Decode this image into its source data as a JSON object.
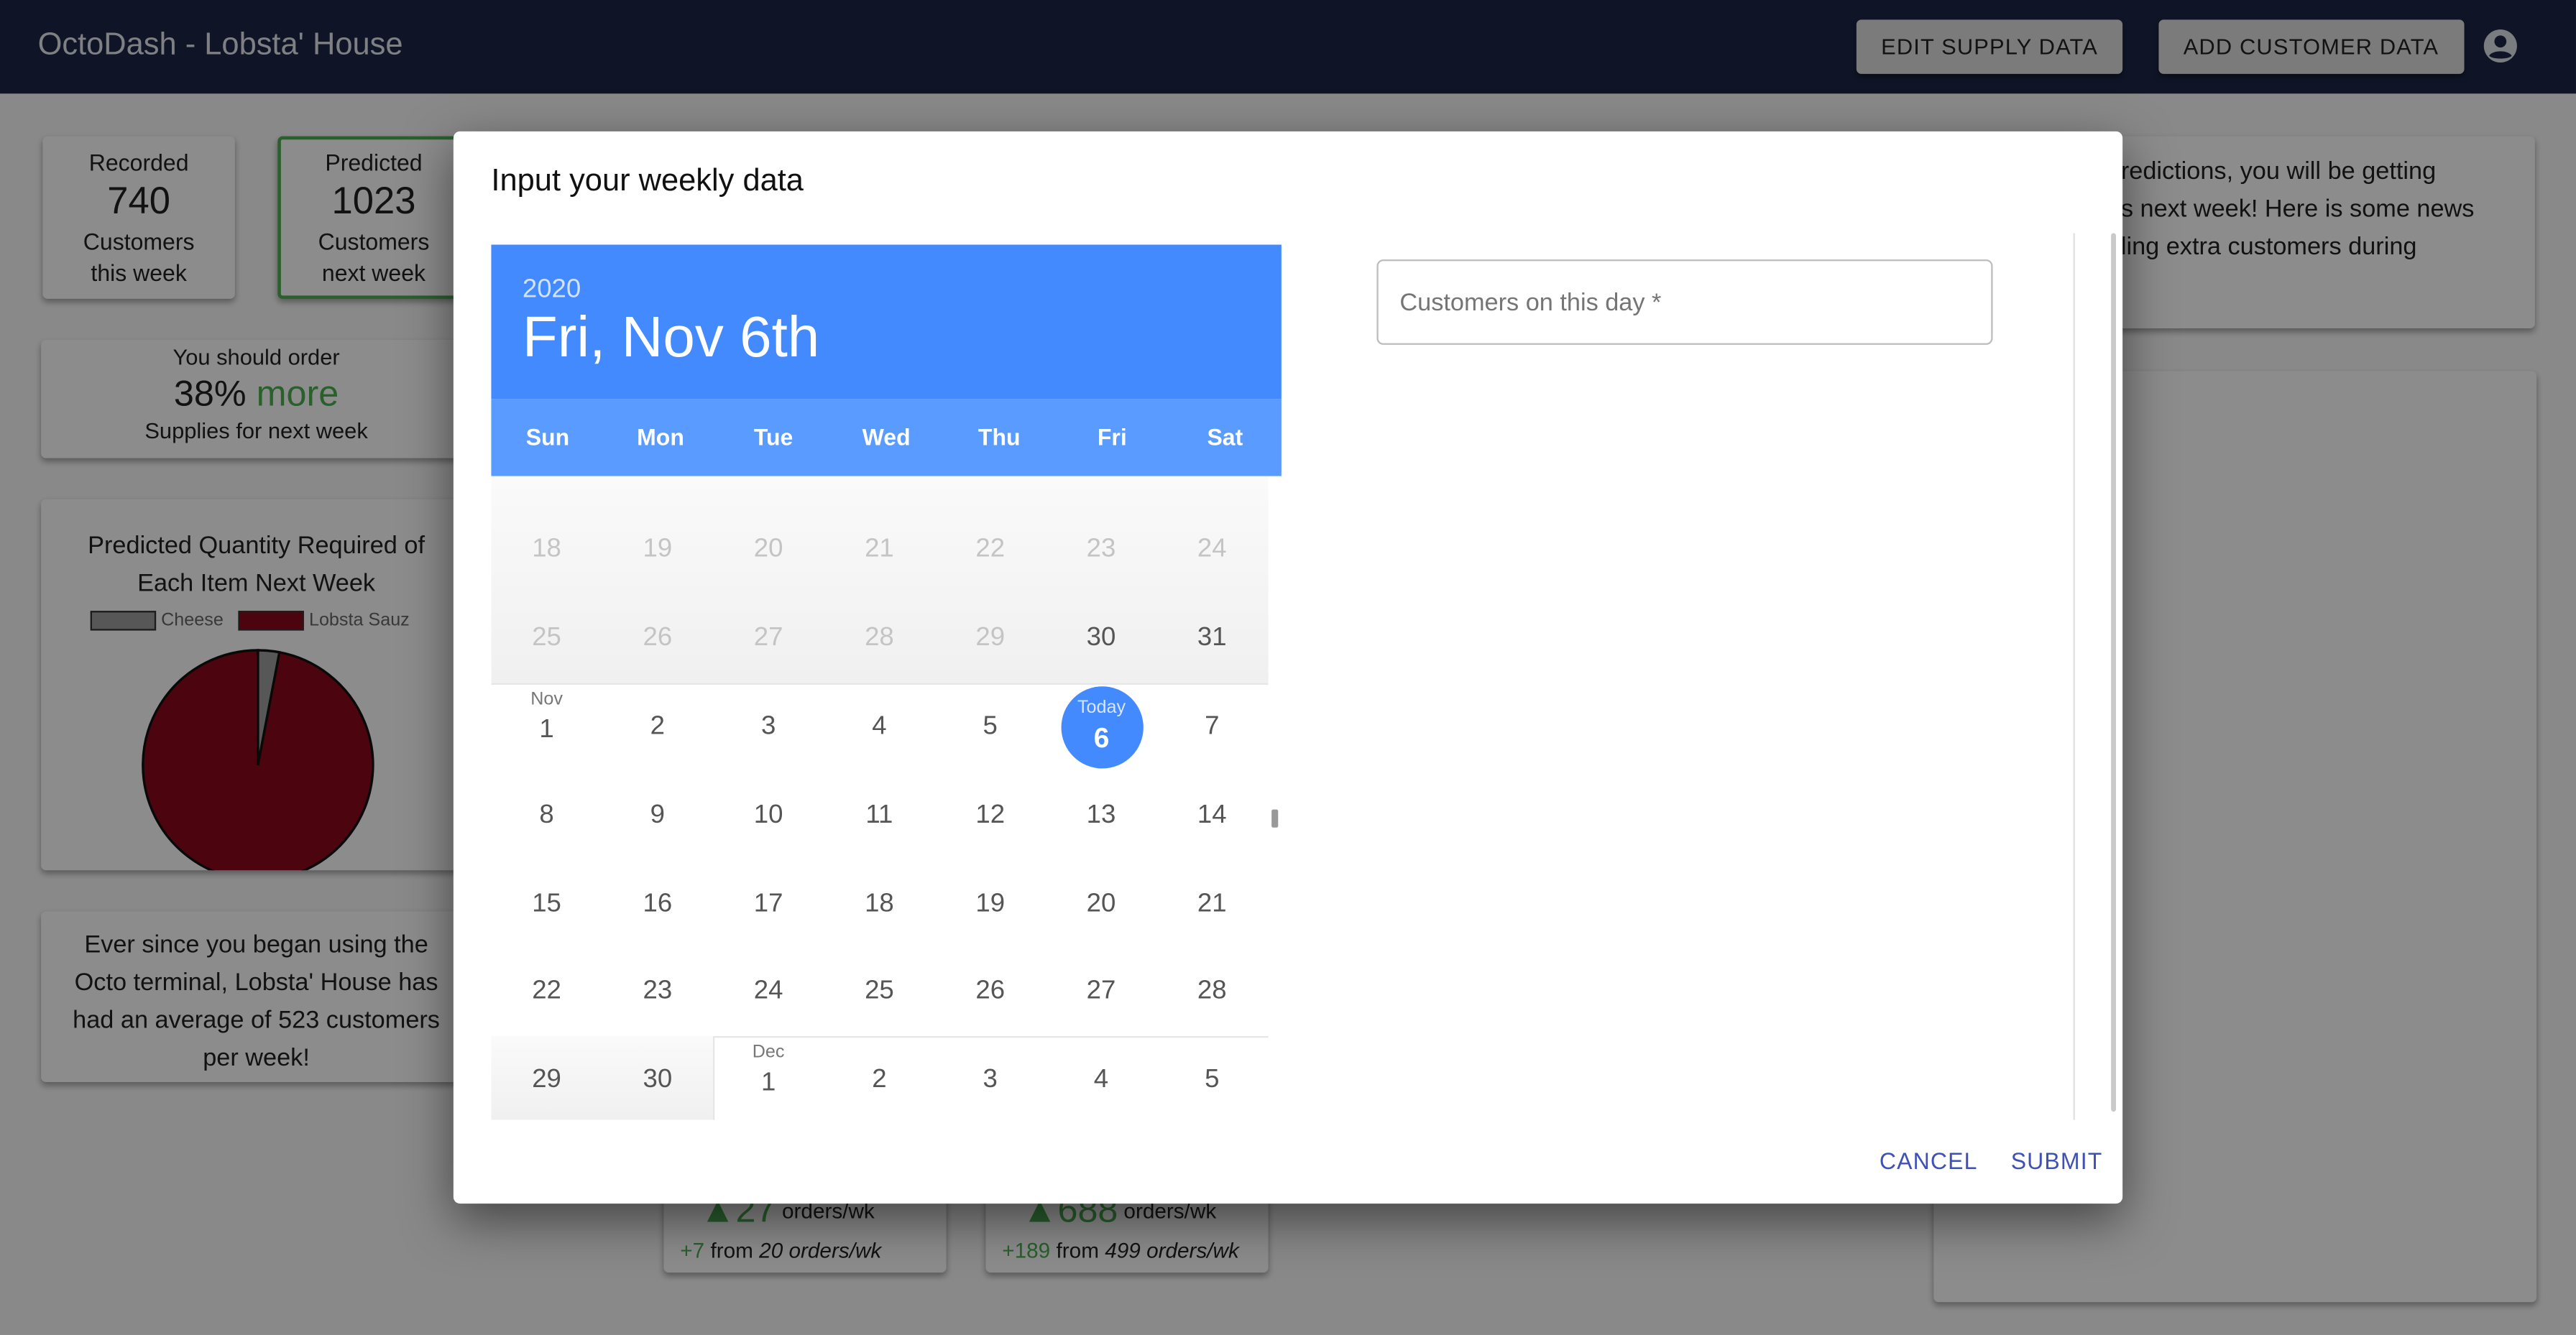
{
  "app": {
    "title": "OctoDash - Lobsta' House",
    "edit_supply_label": "EDIT SUPPLY DATA",
    "add_customer_label": "ADD CUSTOMER DATA",
    "account_icon": "account-circle-icon"
  },
  "stats": {
    "recorded": {
      "top": "Recorded",
      "value": "740",
      "line1": "Customers",
      "line2": "this week"
    },
    "predicted": {
      "top": "Predicted",
      "value": "1023",
      "line1": "Customers",
      "line2": "next week"
    }
  },
  "order": {
    "top": "You should order",
    "pct": "38%",
    "word": "more",
    "bottom": "Supplies for next week"
  },
  "pie": {
    "title1": "Predicted Quantity Required of",
    "title2": "Each Item Next Week",
    "legend": [
      {
        "name": "Cheese",
        "color": "#9e9e9e"
      },
      {
        "name": "Lobsta Sauz",
        "color": "#8b0a1a"
      }
    ]
  },
  "chart_data": {
    "type": "pie",
    "title": "Predicted Quantity Required of Each Item Next Week",
    "categories": [
      "Cheese",
      "Lobsta Sauz"
    ],
    "values": [
      3,
      97
    ],
    "colors": [
      "#9e9e9e",
      "#8b0a1a"
    ],
    "legend": "top"
  },
  "avg": {
    "line1": "Ever since you began using the",
    "line2": "Octo terminal, Lobsta' House has",
    "line3": "had an average of 523 customers",
    "line4": "per week!"
  },
  "news": {
    "line1": "redictions, you will be getting",
    "line2": "s next week! Here is some news",
    "line3": "ling extra customers during"
  },
  "bottom_cards": [
    {
      "big": "27",
      "unit": "orders/wk",
      "delta": "+7",
      "from_word": "from",
      "from_val": "20 orders/wk"
    },
    {
      "big": "688",
      "unit": "orders/wk",
      "delta": "+189",
      "from_word": "from",
      "from_val": "499 orders/wk"
    }
  ],
  "dialog": {
    "title": "Input your weekly data",
    "year": "2020",
    "date_label": "Fri, Nov 6th",
    "weekdays": [
      "Sun",
      "Mon",
      "Tue",
      "Wed",
      "Thu",
      "Fri",
      "Sat"
    ],
    "oct_rows": [
      [
        "18",
        "19",
        "20",
        "21",
        "22",
        "23",
        "24"
      ],
      [
        "25",
        "26",
        "27",
        "28",
        "29",
        "30",
        "31"
      ]
    ],
    "nov_label": "Nov",
    "dec_label": "Dec",
    "today_label": "Today",
    "nov_rows": [
      [
        "1",
        "2",
        "3",
        "4",
        "5",
        "6",
        "7"
      ],
      [
        "8",
        "9",
        "10",
        "11",
        "12",
        "13",
        "14"
      ],
      [
        "15",
        "16",
        "17",
        "18",
        "19",
        "20",
        "21"
      ],
      [
        "22",
        "23",
        "24",
        "25",
        "26",
        "27",
        "28"
      ],
      [
        "29",
        "30"
      ]
    ],
    "dec_row": [
      "1",
      "2",
      "3",
      "4",
      "5"
    ],
    "input_placeholder": "Customers on this day *",
    "input_value": "",
    "cancel_label": "CANCEL",
    "submit_label": "SUBMIT"
  }
}
